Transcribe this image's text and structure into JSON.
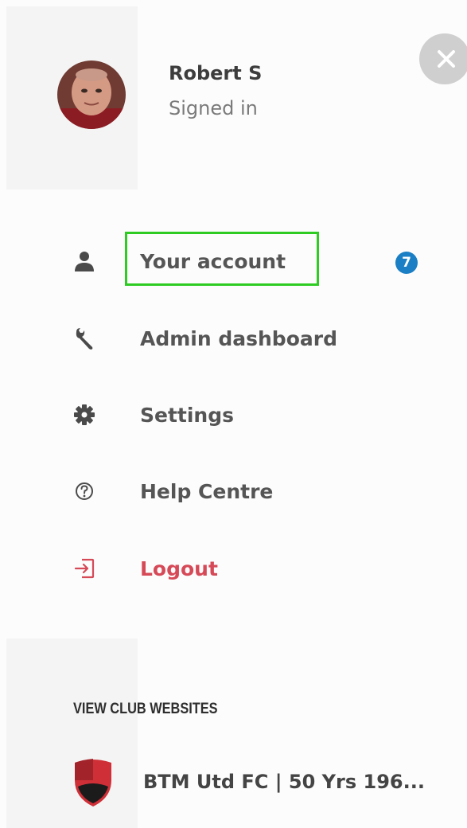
{
  "profile": {
    "name": "Robert S",
    "status": "Signed in",
    "avatar_icon": "user-photo"
  },
  "close_icon": "close-icon",
  "menu": {
    "items": [
      {
        "label": "Your account",
        "icon": "person-icon"
      },
      {
        "label": "Admin dashboard",
        "icon": "wrench-icon"
      },
      {
        "label": "Settings",
        "icon": "gear-icon"
      },
      {
        "label": "Help Centre",
        "icon": "help-circle-icon"
      },
      {
        "label": "Logout",
        "icon": "logout-icon"
      }
    ],
    "account_badge": "7"
  },
  "clubs": {
    "heading": "VIEW CLUB WEBSITES",
    "items": [
      {
        "name": "BTM Utd FC | 50 Yrs 196...",
        "icon": "club-crest-icon"
      }
    ]
  },
  "colors": {
    "badge": "#1a7fc4",
    "logout": "#d64a58",
    "highlight": "#2ecc22"
  }
}
